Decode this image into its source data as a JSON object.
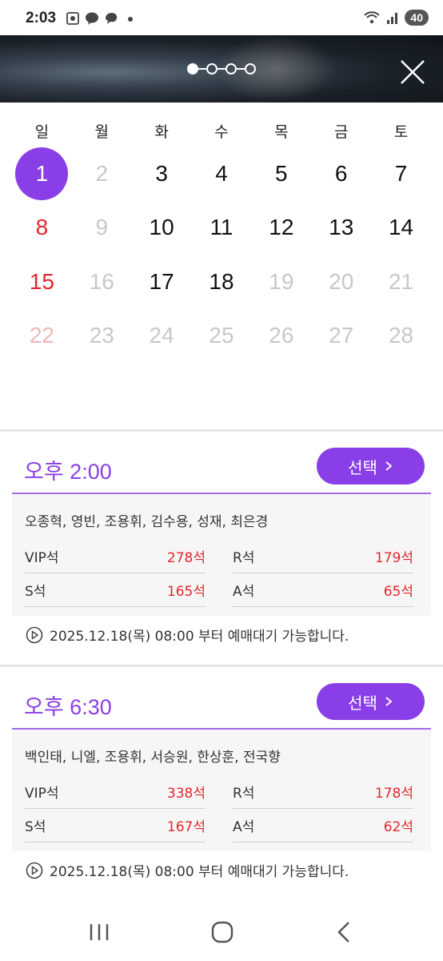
{
  "status_bar": {
    "time": "2:03",
    "battery": "40",
    "icons": [
      "screenshot-icon",
      "talk-icon",
      "chat-bubble-icon",
      "dot-icon",
      "wifi-icon",
      "signal-icon"
    ]
  },
  "header": {
    "steps_total": 4,
    "current_step": 1,
    "close_icon": "close-icon"
  },
  "calendar": {
    "weekdays": [
      "일",
      "월",
      "화",
      "수",
      "목",
      "금",
      "토"
    ],
    "days": [
      {
        "d": "1",
        "state": "selected"
      },
      {
        "d": "2",
        "state": "inactive"
      },
      {
        "d": "3",
        "state": "active"
      },
      {
        "d": "4",
        "state": "active"
      },
      {
        "d": "5",
        "state": "active"
      },
      {
        "d": "6",
        "state": "active"
      },
      {
        "d": "7",
        "state": "active"
      },
      {
        "d": "8",
        "state": "sunday"
      },
      {
        "d": "9",
        "state": "inactive"
      },
      {
        "d": "10",
        "state": "active"
      },
      {
        "d": "11",
        "state": "active"
      },
      {
        "d": "12",
        "state": "active"
      },
      {
        "d": "13",
        "state": "active"
      },
      {
        "d": "14",
        "state": "active"
      },
      {
        "d": "15",
        "state": "sunday"
      },
      {
        "d": "16",
        "state": "inactive"
      },
      {
        "d": "17",
        "state": "active"
      },
      {
        "d": "18",
        "state": "active"
      },
      {
        "d": "19",
        "state": "inactive"
      },
      {
        "d": "20",
        "state": "inactive"
      },
      {
        "d": "21",
        "state": "inactive"
      },
      {
        "d": "22",
        "state": "sunday-inactive"
      },
      {
        "d": "23",
        "state": "inactive"
      },
      {
        "d": "24",
        "state": "inactive"
      },
      {
        "d": "25",
        "state": "inactive"
      },
      {
        "d": "26",
        "state": "inactive"
      },
      {
        "d": "27",
        "state": "inactive"
      },
      {
        "d": "28",
        "state": "inactive"
      }
    ]
  },
  "sessions": [
    {
      "time": "오후 2:00",
      "select_label": "선택",
      "cast": "오종혁, 영빈, 조용휘, 김수용, 성재, 최은경",
      "seats": [
        {
          "name": "VIP석",
          "count": "278석"
        },
        {
          "name": "R석",
          "count": "179석"
        },
        {
          "name": "S석",
          "count": "165석"
        },
        {
          "name": "A석",
          "count": "65석"
        }
      ],
      "notice": "2025.12.18(목) 08:00 부터 예매대기 가능합니다."
    },
    {
      "time": "오후 6:30",
      "select_label": "선택",
      "cast": "백인태, 니엘, 조용휘, 서승원, 한상훈, 전국향",
      "seats": [
        {
          "name": "VIP석",
          "count": "338석"
        },
        {
          "name": "R석",
          "count": "178석"
        },
        {
          "name": "S석",
          "count": "167석"
        },
        {
          "name": "A석",
          "count": "62석"
        }
      ],
      "notice": "2025.12.18(목) 08:00 부터 예매대기 가능합니다."
    }
  ],
  "colors": {
    "accent": "#8a3ee8",
    "sunday_red": "#e0282e",
    "inactive_gray": "#c8c8c8"
  }
}
